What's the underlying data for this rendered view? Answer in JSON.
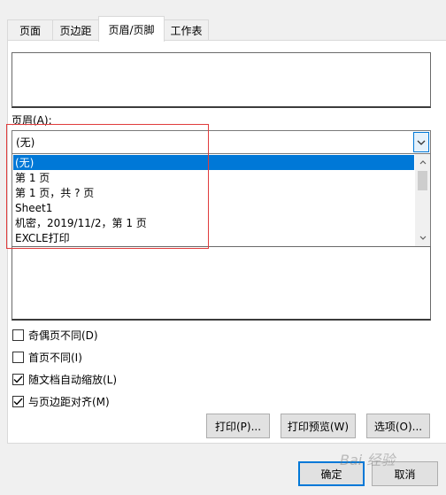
{
  "tabs": [
    {
      "label": "页面"
    },
    {
      "label": "页边距"
    },
    {
      "label": "页眉/页脚"
    },
    {
      "label": "工作表"
    }
  ],
  "active_tab": "页眉/页脚",
  "header": {
    "label": "页眉(A):",
    "selected_value": "(无)",
    "options": [
      "(无)",
      "第 1 页",
      "第 1 页，共 ? 页",
      "Sheet1",
      " 机密，2019/11/2，第 1 页",
      "EXCLE打印"
    ]
  },
  "checkboxes": [
    {
      "label": "奇偶页不同(D)",
      "checked": false
    },
    {
      "label": "首页不同(I)",
      "checked": false
    },
    {
      "label": "随文档自动缩放(L)",
      "checked": true
    },
    {
      "label": "与页边距对齐(M)",
      "checked": true
    }
  ],
  "buttons": {
    "print": "打印(P)...",
    "preview": "打印预览(W)",
    "options": "选项(O)...",
    "ok": "确定",
    "cancel": "取消"
  },
  "watermark": "Bai 经验",
  "colors": {
    "selection": "#0078d7",
    "highlight_box": "#e03c3c"
  }
}
